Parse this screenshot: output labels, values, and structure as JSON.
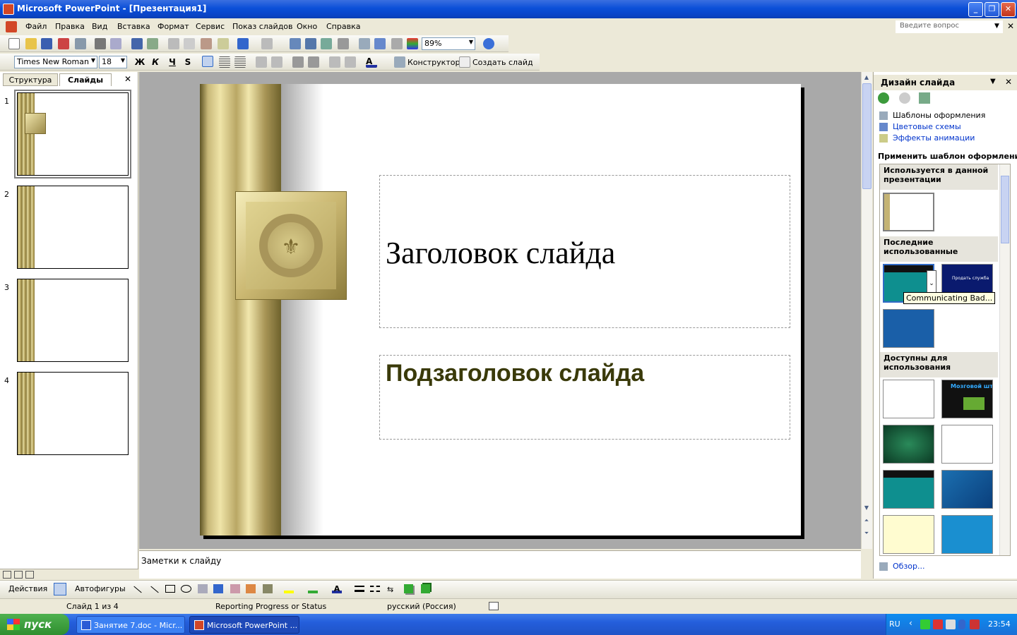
{
  "titlebar": {
    "title": "Microsoft PowerPoint - [Презентация1]"
  },
  "menu": {
    "items": [
      "Файл",
      "Правка",
      "Вид",
      "Вставка",
      "Формат",
      "Сервис",
      "Показ слайдов",
      "Окно",
      "Справка"
    ],
    "ask_placeholder": "Введите вопрос"
  },
  "toolbar": {
    "zoom": "89%",
    "font": "Times New Roman",
    "size": "18",
    "bold": "Ж",
    "italic": "К",
    "underline": "Ч",
    "shadow": "S",
    "designer": "Конструктор",
    "new_slide": "Создать слайд"
  },
  "left_pane": {
    "tab_outline": "Структура",
    "tab_slides": "Слайды",
    "slides": [
      "1",
      "2",
      "3",
      "4"
    ]
  },
  "slide": {
    "title": "Заголовок слайда",
    "subtitle": "Подзаголовок слайда"
  },
  "notes": {
    "label": "Заметки к слайду"
  },
  "task_pane": {
    "title": "Дизайн слайда",
    "links": [
      "Шаблоны оформления",
      "Цветовые схемы",
      "Эффекты анимации"
    ],
    "apply_label": "Применить шаблон оформления:",
    "sec_used": "Используется в данной презентации",
    "sec_recent": "Последние использованные",
    "sec_available": "Доступны для использования",
    "tooltip": "Communicating Bad...",
    "browse": "Обзор..."
  },
  "template_text": {
    "t2": "Продать служба",
    "t6": "Мозговой штурм"
  },
  "drawbar": {
    "actions": "Действия",
    "autoshapes": "Автофигуры"
  },
  "status": {
    "slide": "Слайд 1 из 4",
    "progress": "Reporting Progress or Status",
    "lang": "русский (Россия)"
  },
  "taskbar": {
    "start": "пуск",
    "task1": "Занятие 7.doc - Micr...",
    "task2": "Microsoft PowerPoint ...",
    "lang": "RU",
    "time": "23:54"
  }
}
